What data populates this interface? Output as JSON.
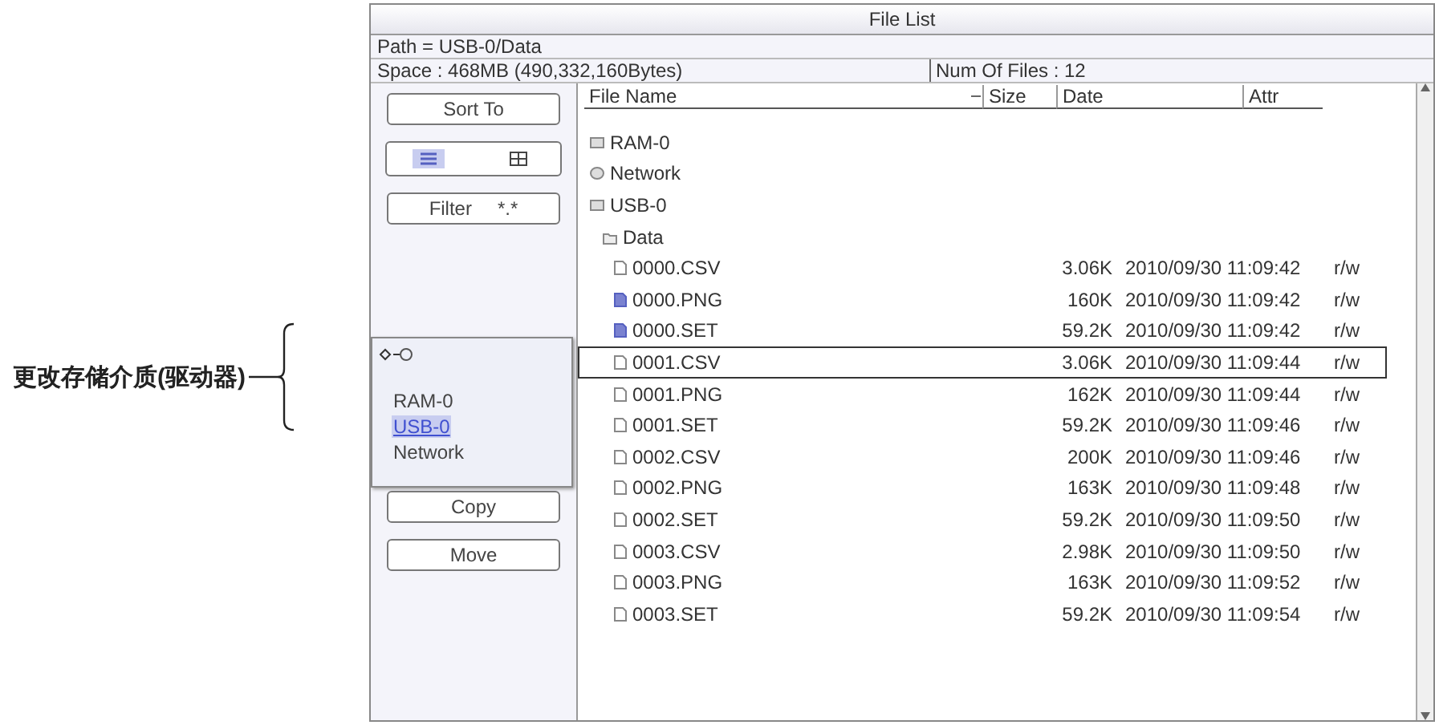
{
  "annotation": {
    "label": "更改存储介质(驱动器)"
  },
  "window": {
    "title": "File List"
  },
  "info": {
    "path": "Path = USB-0/Data",
    "space": "Space : 468MB (490,332,160Bytes)",
    "num_files": "Num Of Files : 12"
  },
  "sidebar": {
    "sort_button": "Sort To",
    "views": [
      {
        "kind": "list",
        "selected": true
      },
      {
        "kind": "grid",
        "selected": false
      }
    ],
    "filter": {
      "label": "Filter",
      "value": "*.*"
    },
    "drive_menu": [
      {
        "label": "RAM-0",
        "selected": false
      },
      {
        "label": "USB-0",
        "selected": true
      },
      {
        "label": "Network",
        "selected": false
      }
    ],
    "buttons": [
      "Copy",
      "Move"
    ]
  },
  "table": {
    "columns": [
      "File Name",
      "Size",
      "Date",
      "Attr"
    ],
    "rows": [
      {
        "kind": "drive",
        "name": "RAM-0",
        "selected": false
      },
      {
        "kind": "network",
        "name": "Network",
        "selected": false
      },
      {
        "kind": "drive",
        "name": "USB-0",
        "selected": false
      },
      {
        "kind": "folder",
        "name": "Data",
        "selected": false
      },
      {
        "kind": "file",
        "name": "0000.CSV",
        "size": "3.06K",
        "date": "2010/09/30 11:09:42",
        "attr": "r/w",
        "selected": false
      },
      {
        "kind": "image",
        "name": "0000.PNG",
        "size": "160K",
        "date": "2010/09/30 11:09:42",
        "attr": "r/w",
        "selected": false
      },
      {
        "kind": "image",
        "name": "0000.SET",
        "size": "59.2K",
        "date": "2010/09/30 11:09:42",
        "attr": "r/w",
        "selected": false
      },
      {
        "kind": "file",
        "name": "0001.CSV",
        "size": "3.06K",
        "date": "2010/09/30 11:09:44",
        "attr": "r/w",
        "selected": true
      },
      {
        "kind": "file",
        "name": "0001.PNG",
        "size": "162K",
        "date": "2010/09/30 11:09:44",
        "attr": "r/w",
        "selected": false
      },
      {
        "kind": "file",
        "name": "0001.SET",
        "size": "59.2K",
        "date": "2010/09/30 11:09:46",
        "attr": "r/w",
        "selected": false
      },
      {
        "kind": "file",
        "name": "0002.CSV",
        "size": "200K",
        "date": "2010/09/30 11:09:46",
        "attr": "r/w",
        "selected": false
      },
      {
        "kind": "file",
        "name": "0002.PNG",
        "size": "163K",
        "date": "2010/09/30 11:09:48",
        "attr": "r/w",
        "selected": false
      },
      {
        "kind": "file",
        "name": "0002.SET",
        "size": "59.2K",
        "date": "2010/09/30 11:09:50",
        "attr": "r/w",
        "selected": false
      },
      {
        "kind": "file",
        "name": "0003.CSV",
        "size": "2.98K",
        "date": "2010/09/30 11:09:50",
        "attr": "r/w",
        "selected": false
      },
      {
        "kind": "file",
        "name": "0003.PNG",
        "size": "163K",
        "date": "2010/09/30 11:09:52",
        "attr": "r/w",
        "selected": false
      },
      {
        "kind": "file",
        "name": "0003.SET",
        "size": "59.2K",
        "date": "2010/09/30 11:09:54",
        "attr": "r/w",
        "selected": false
      }
    ]
  }
}
